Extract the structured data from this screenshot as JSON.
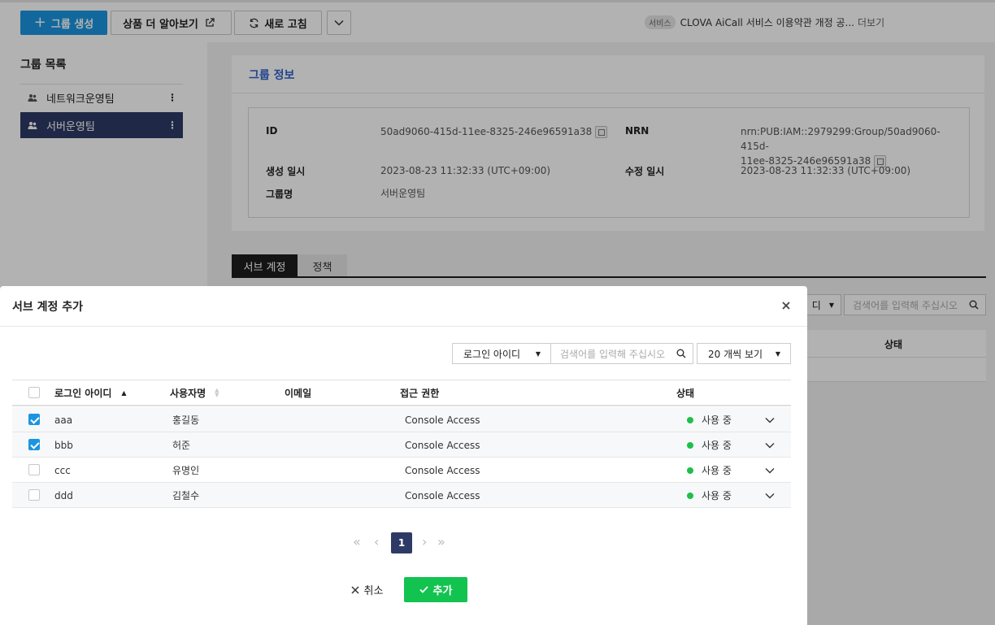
{
  "toolbar": {
    "create_group": "그룹 생성",
    "learn_more": "상품 더 알아보기",
    "refresh": "새로 고침",
    "notice_badge": "서비스",
    "notice_text": "CLOVA AiCall 서비스 이용약관 개정 공...",
    "notice_more": "더보기"
  },
  "sidebar": {
    "title": "그룹 목록",
    "items": [
      {
        "label": "네트워크운영팀",
        "selected": false
      },
      {
        "label": "서버운영팀",
        "selected": true
      }
    ]
  },
  "group_info": {
    "title": "그룹 정보",
    "id_label": "ID",
    "id_value": "50ad9060-415d-11ee-8325-246e96591a38",
    "nrn_label": "NRN",
    "nrn_value_line1": "nrn:PUB:IAM::2979299:Group/50ad9060-415d-",
    "nrn_value_line2": "11ee-8325-246e96591a38",
    "created_label": "생성 일시",
    "created_value": "2023-08-23 11:32:33 (UTC+09:00)",
    "modified_label": "수정 일시",
    "modified_value": "2023-08-23 11:32:33 (UTC+09:00)",
    "name_label": "그룹명",
    "name_value": "서버운영팀"
  },
  "tabs": [
    {
      "label": "서브 계정",
      "active": true
    },
    {
      "label": "정책",
      "active": false
    }
  ],
  "background_table": {
    "filter_suffix": "디",
    "search_placeholder": "검색어를 입력해 주십시오",
    "status_header": "상태"
  },
  "modal": {
    "title": "서브 계정 추가",
    "filter_select": "로그인 아이디",
    "search_placeholder": "검색어를 입력해 주십시오",
    "page_size": "20 개씩 보기",
    "headers": {
      "login_id": "로그인 아이디",
      "user_name": "사용자명",
      "email": "이메일",
      "access": "접근 권한",
      "status": "상태"
    },
    "rows": [
      {
        "login_id": "aaa",
        "user_name": "홍길동",
        "email": "",
        "access": "Console Access",
        "status": "사용 중",
        "checked": true
      },
      {
        "login_id": "bbb",
        "user_name": "허준",
        "email": "",
        "access": "Console Access",
        "status": "사용 중",
        "checked": true
      },
      {
        "login_id": "ccc",
        "user_name": "유명인",
        "email": "",
        "access": "Console Access",
        "status": "사용 중",
        "checked": false
      },
      {
        "login_id": "ddd",
        "user_name": "김철수",
        "email": "",
        "access": "Console Access",
        "status": "사용 중",
        "checked": false
      }
    ],
    "pagination": {
      "current": "1"
    },
    "cancel_label": "취소",
    "add_label": "추가"
  },
  "colors": {
    "primary": "#1b95e0",
    "sidebar_selected": "#2e3a66",
    "status_active": "#1fbf4a",
    "add_button": "#12c350",
    "page_active": "#2e3a66"
  }
}
